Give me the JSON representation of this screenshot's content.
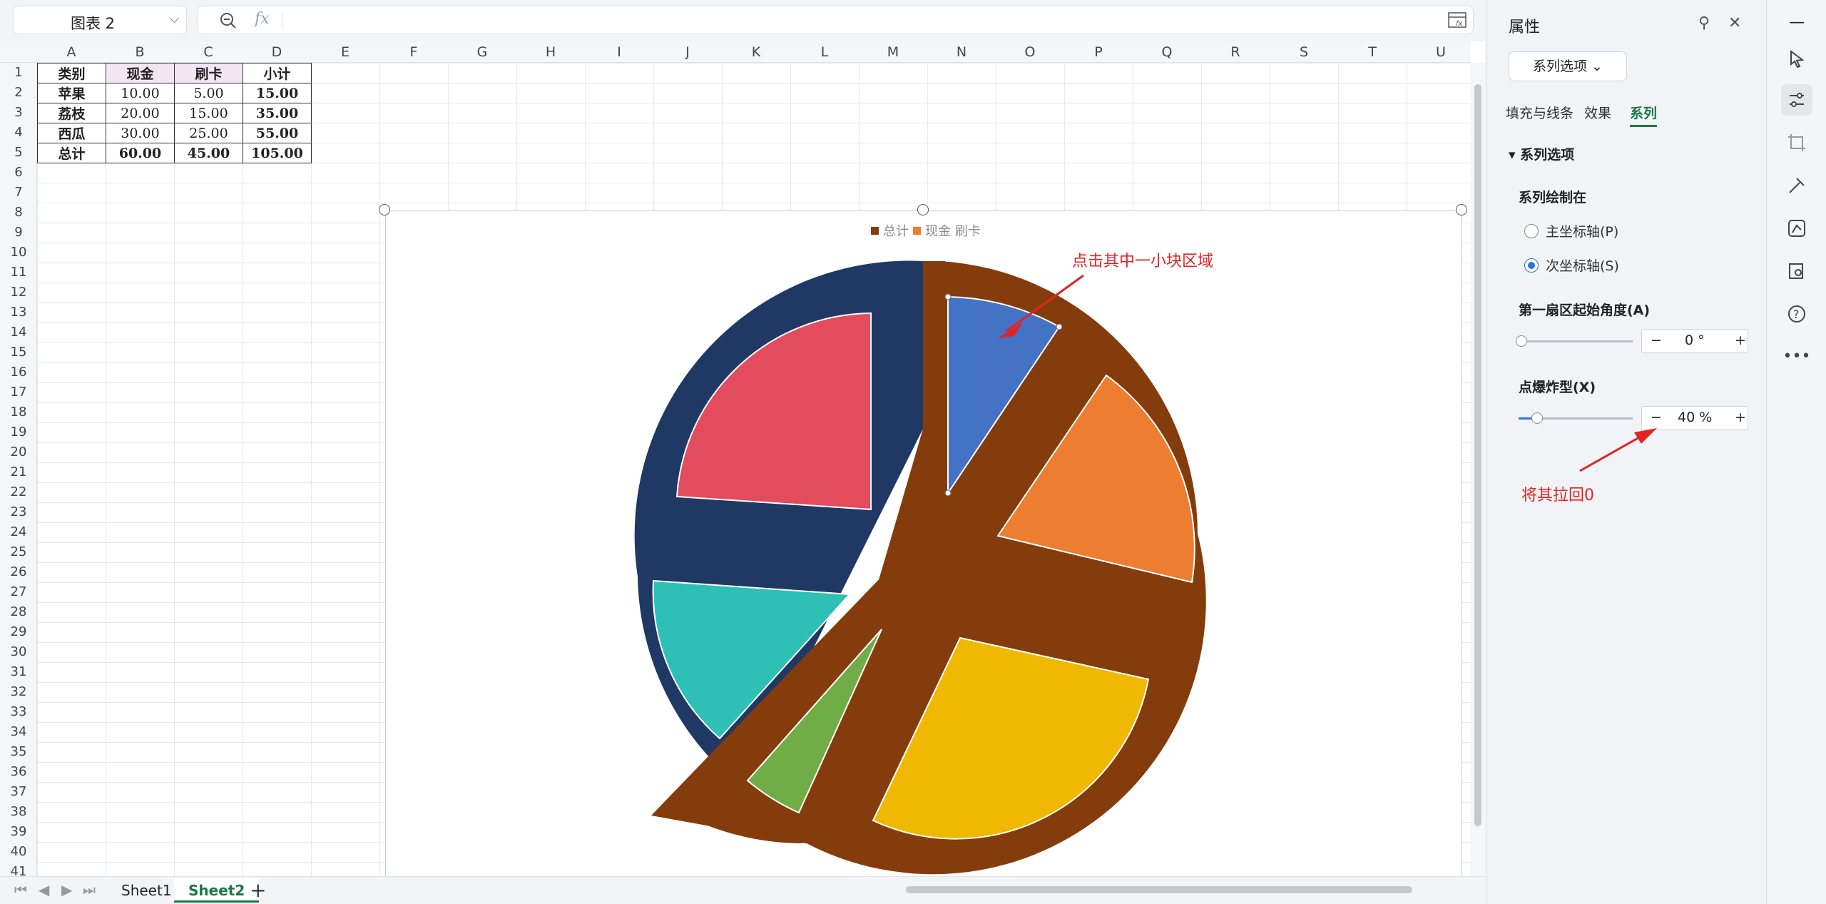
{
  "namebox": {
    "value": "图表 2"
  },
  "formula": {
    "fx_label": "fx"
  },
  "columns": [
    "A",
    "B",
    "C",
    "D",
    "E",
    "F",
    "G",
    "H",
    "I",
    "J",
    "K",
    "L",
    "M",
    "N",
    "O",
    "P",
    "Q",
    "R",
    "S",
    "T",
    "U"
  ],
  "rows": [
    "1",
    "2",
    "3",
    "4",
    "5",
    "6",
    "7",
    "8",
    "9",
    "10",
    "11",
    "12",
    "13",
    "14",
    "15",
    "16",
    "17",
    "18",
    "19",
    "20",
    "21",
    "22",
    "23",
    "24",
    "25",
    "26",
    "27",
    "28",
    "29",
    "30",
    "31",
    "32",
    "33",
    "34",
    "35",
    "36",
    "37",
    "38",
    "39",
    "40",
    "41"
  ],
  "table": [
    [
      "类别",
      "现金",
      "刷卡",
      "小计"
    ],
    [
      "苹果",
      "10.00",
      "5.00",
      "15.00"
    ],
    [
      "荔枝",
      "20.00",
      "15.00",
      "35.00"
    ],
    [
      "西瓜",
      "30.00",
      "25.00",
      "55.00"
    ],
    [
      "总计",
      "60.00",
      "45.00",
      "105.00"
    ]
  ],
  "chart_data": {
    "type": "pie",
    "legend": [
      "总计",
      "现金 刷卡"
    ],
    "series": [
      {
        "name": "总计",
        "color": "#843c0c"
      },
      {
        "name": "现金 刷卡",
        "color": "#ed7d31"
      }
    ],
    "colors": {
      "outer_left": "#1f3864",
      "outer_right": "#843c0c",
      "blue": "#4472c4",
      "orange": "#ed7d31",
      "yellow": "#f0b800",
      "green": "#70ad47",
      "teal": "#2ec0b4",
      "red": "#e24c5d"
    }
  },
  "annotations": {
    "top": "点击其中一小块区域",
    "bottom": "将其拉回0"
  },
  "sheets": [
    "Sheet1",
    "Sheet2"
  ],
  "panel": {
    "title": "属性",
    "series_button": "系列选项",
    "tabs": [
      "填充与线条",
      "效果",
      "系列"
    ],
    "section": "系列选项",
    "plot_on_label": "系列绘制在",
    "primary_axis": "主坐标轴(P)",
    "secondary_axis": "次坐标轴(S)",
    "first_angle_label": "第一扇区起始角度(A)",
    "first_angle_value": "0 °",
    "explode_label": "点爆炸型(X)",
    "explode_value": "40 %",
    "explode_percent": 40
  }
}
